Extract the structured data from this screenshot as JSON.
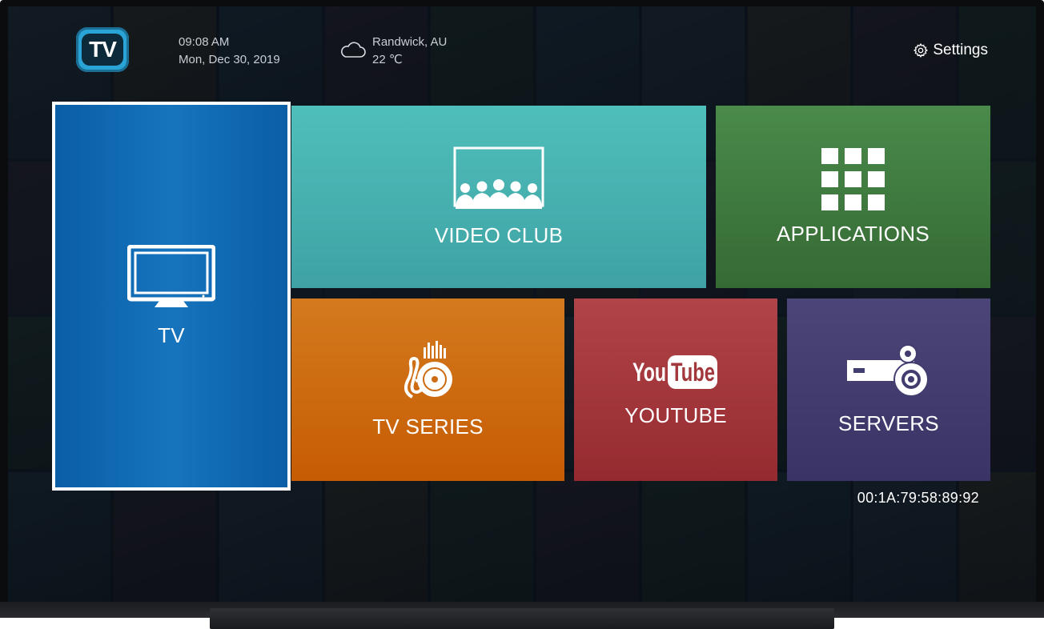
{
  "header": {
    "logo_text": "TV",
    "time": "09:08 AM",
    "date": "Mon, Dec 30, 2019",
    "location": "Randwick, AU",
    "temperature": "22 ℃",
    "weather_icon": "cloud-icon",
    "settings_label": "Settings",
    "settings_icon": "gear-icon"
  },
  "tiles": {
    "tv": {
      "label": "TV",
      "icon": "tv-monitor-icon",
      "selected": true
    },
    "video_club": {
      "label": "VIDEO CLUB",
      "icon": "cinema-audience-icon"
    },
    "applications": {
      "label": "APPLICATIONS",
      "icon": "app-grid-icon"
    },
    "tv_series": {
      "label": "TV SERIES",
      "icon": "music-disc-icon"
    },
    "youtube": {
      "label": "YOUTUBE",
      "icon": "youtube-logo-icon",
      "logo_text_you": "You",
      "logo_text_tube": "Tube"
    },
    "servers": {
      "label": "SERVERS",
      "icon": "server-gears-icon"
    }
  },
  "footer": {
    "mac_address": "00:1A:79:58:89:92"
  },
  "colors": {
    "tv_tile": "#1674bd",
    "video_club_tile": "#46b0ae",
    "applications_tile": "#40793f",
    "tv_series_tile": "#cd6b10",
    "youtube_tile": "#a2373c",
    "servers_tile": "#423d6f",
    "logo": "#2aa3d6"
  }
}
